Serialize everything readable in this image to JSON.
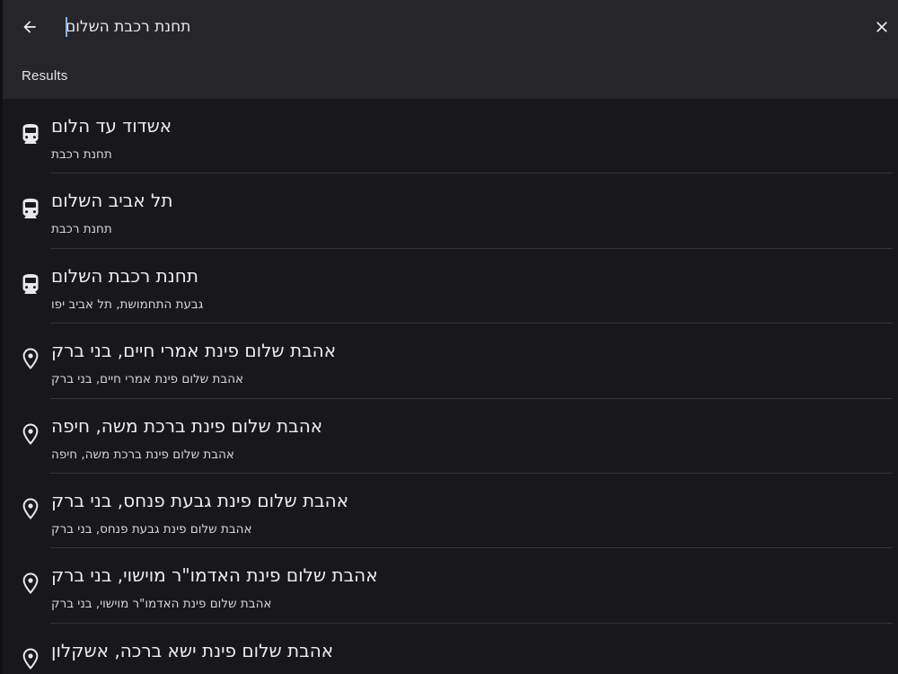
{
  "search": {
    "query": "תחנת רכבת השלום"
  },
  "results_label": "Results",
  "results": [
    {
      "icon": "train-icon",
      "title": "אשדוד עד הלום",
      "subtitle": "תחנת רכבת"
    },
    {
      "icon": "train-icon",
      "title": "תל אביב השלום",
      "subtitle": "תחנת רכבת"
    },
    {
      "icon": "train-icon",
      "title": "תחנת רכבת השלום",
      "subtitle": "גבעת התחמושת, תל אביב יפו"
    },
    {
      "icon": "location-pin-icon",
      "title": "אהבת שלום פינת אמרי חיים, בני ברק",
      "subtitle": "אהבת שלום פינת אמרי חיים, בני ברק"
    },
    {
      "icon": "location-pin-icon",
      "title": "אהבת שלום פינת ברכת משה, חיפה",
      "subtitle": "אהבת שלום פינת ברכת משה, חיפה"
    },
    {
      "icon": "location-pin-icon",
      "title": "אהבת שלום פינת גבעת פנחס, בני ברק",
      "subtitle": "אהבת שלום פינת גבעת פנחס, בני ברק"
    },
    {
      "icon": "location-pin-icon",
      "title": "אהבת שלום פינת האדמו\"ר מוישוי, בני ברק",
      "subtitle": "אהבת שלום פינת האדמו\"ר מוישוי, בני ברק"
    },
    {
      "icon": "location-pin-icon",
      "title": "אהבת שלום פינת ישא ברכה, אשקלון",
      "subtitle": ""
    }
  ],
  "colors": {
    "background": "#18181a",
    "header": "#262628",
    "text": "#ececee",
    "caret": "#8ab4f8"
  }
}
